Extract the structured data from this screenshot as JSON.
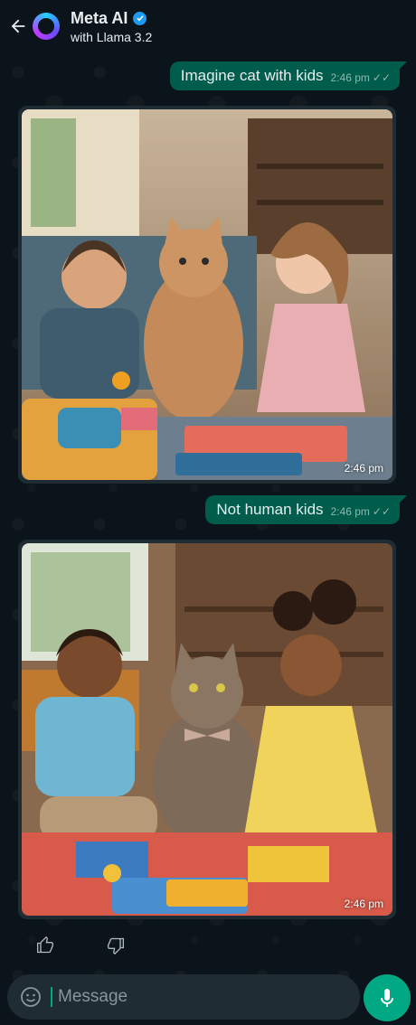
{
  "header": {
    "title": "Meta AI",
    "subtitle": "with Llama 3.2",
    "icons": [
      "back-arrow-icon",
      "meta-ai-avatar",
      "verified-badge-icon"
    ]
  },
  "messages": [
    {
      "type": "outgoing",
      "text": "Imagine cat with kids",
      "time": "2:46 pm",
      "status": "read"
    },
    {
      "type": "incoming-image",
      "caption_alt": "",
      "time": "2:46 pm"
    },
    {
      "type": "outgoing",
      "text": "Not human kids",
      "time": "2:46 pm",
      "status": "read"
    },
    {
      "type": "incoming-image",
      "caption_alt": "",
      "time": "2:46 pm"
    }
  ],
  "reactions": {
    "icons": [
      "thumbs-up-icon",
      "thumbs-down-icon"
    ]
  },
  "composer": {
    "placeholder": "Message",
    "icons": [
      "emoji-icon",
      "mic-icon"
    ]
  },
  "colors": {
    "background": "#0b141a",
    "outgoing_bubble": "#005c4b",
    "incoming_bubble": "#1f2c33",
    "accent": "#00a884",
    "verified": "#1d9bf0"
  }
}
